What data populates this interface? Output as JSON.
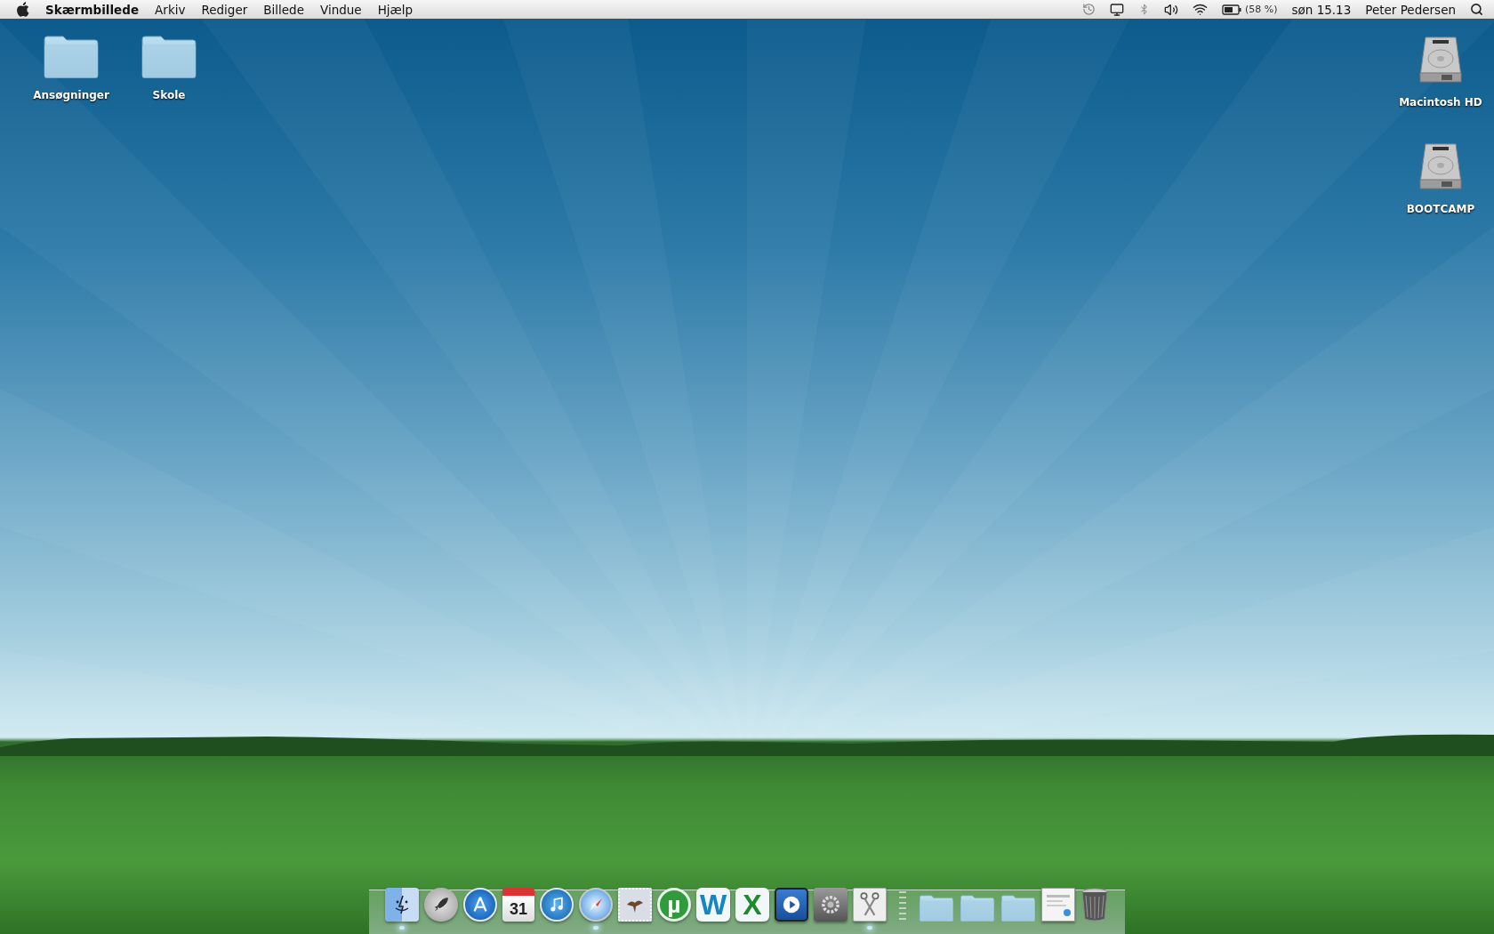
{
  "menu_bar": {
    "app_name": "Skærmbillede",
    "menus": [
      "Arkiv",
      "Rediger",
      "Billede",
      "Vindue",
      "Hjælp"
    ],
    "status": {
      "battery_percent": "(58 %)",
      "clock": "søn 15.13",
      "user": "Peter Pedersen"
    }
  },
  "desktop_icons_left": [
    {
      "kind": "folder",
      "label": "Ansøgninger"
    },
    {
      "kind": "folder",
      "label": "Skole"
    }
  ],
  "desktop_icons_right": [
    {
      "kind": "drive",
      "label": "Macintosh HD"
    },
    {
      "kind": "drive",
      "label": "BOOTCAMP"
    }
  ],
  "dock": [
    {
      "kind": "finder",
      "running": true
    },
    {
      "kind": "launchpad",
      "running": false
    },
    {
      "kind": "appstore",
      "running": false
    },
    {
      "kind": "calendar",
      "glyph": "31",
      "running": false
    },
    {
      "kind": "music",
      "running": false
    },
    {
      "kind": "safari",
      "running": true
    },
    {
      "kind": "mail",
      "running": false
    },
    {
      "kind": "torrent",
      "glyph": "µ",
      "running": false
    },
    {
      "kind": "word",
      "glyph": "W",
      "running": false
    },
    {
      "kind": "excel",
      "glyph": "X",
      "running": false
    },
    {
      "kind": "player",
      "running": false
    },
    {
      "kind": "preferences",
      "running": false
    },
    {
      "kind": "scissors",
      "running": true
    },
    {
      "kind": "separator"
    },
    {
      "kind": "folder-apps",
      "running": false
    },
    {
      "kind": "folder-docs",
      "running": false
    },
    {
      "kind": "folder-downloads",
      "running": false
    },
    {
      "kind": "document",
      "running": false
    },
    {
      "kind": "trash",
      "running": false
    }
  ]
}
